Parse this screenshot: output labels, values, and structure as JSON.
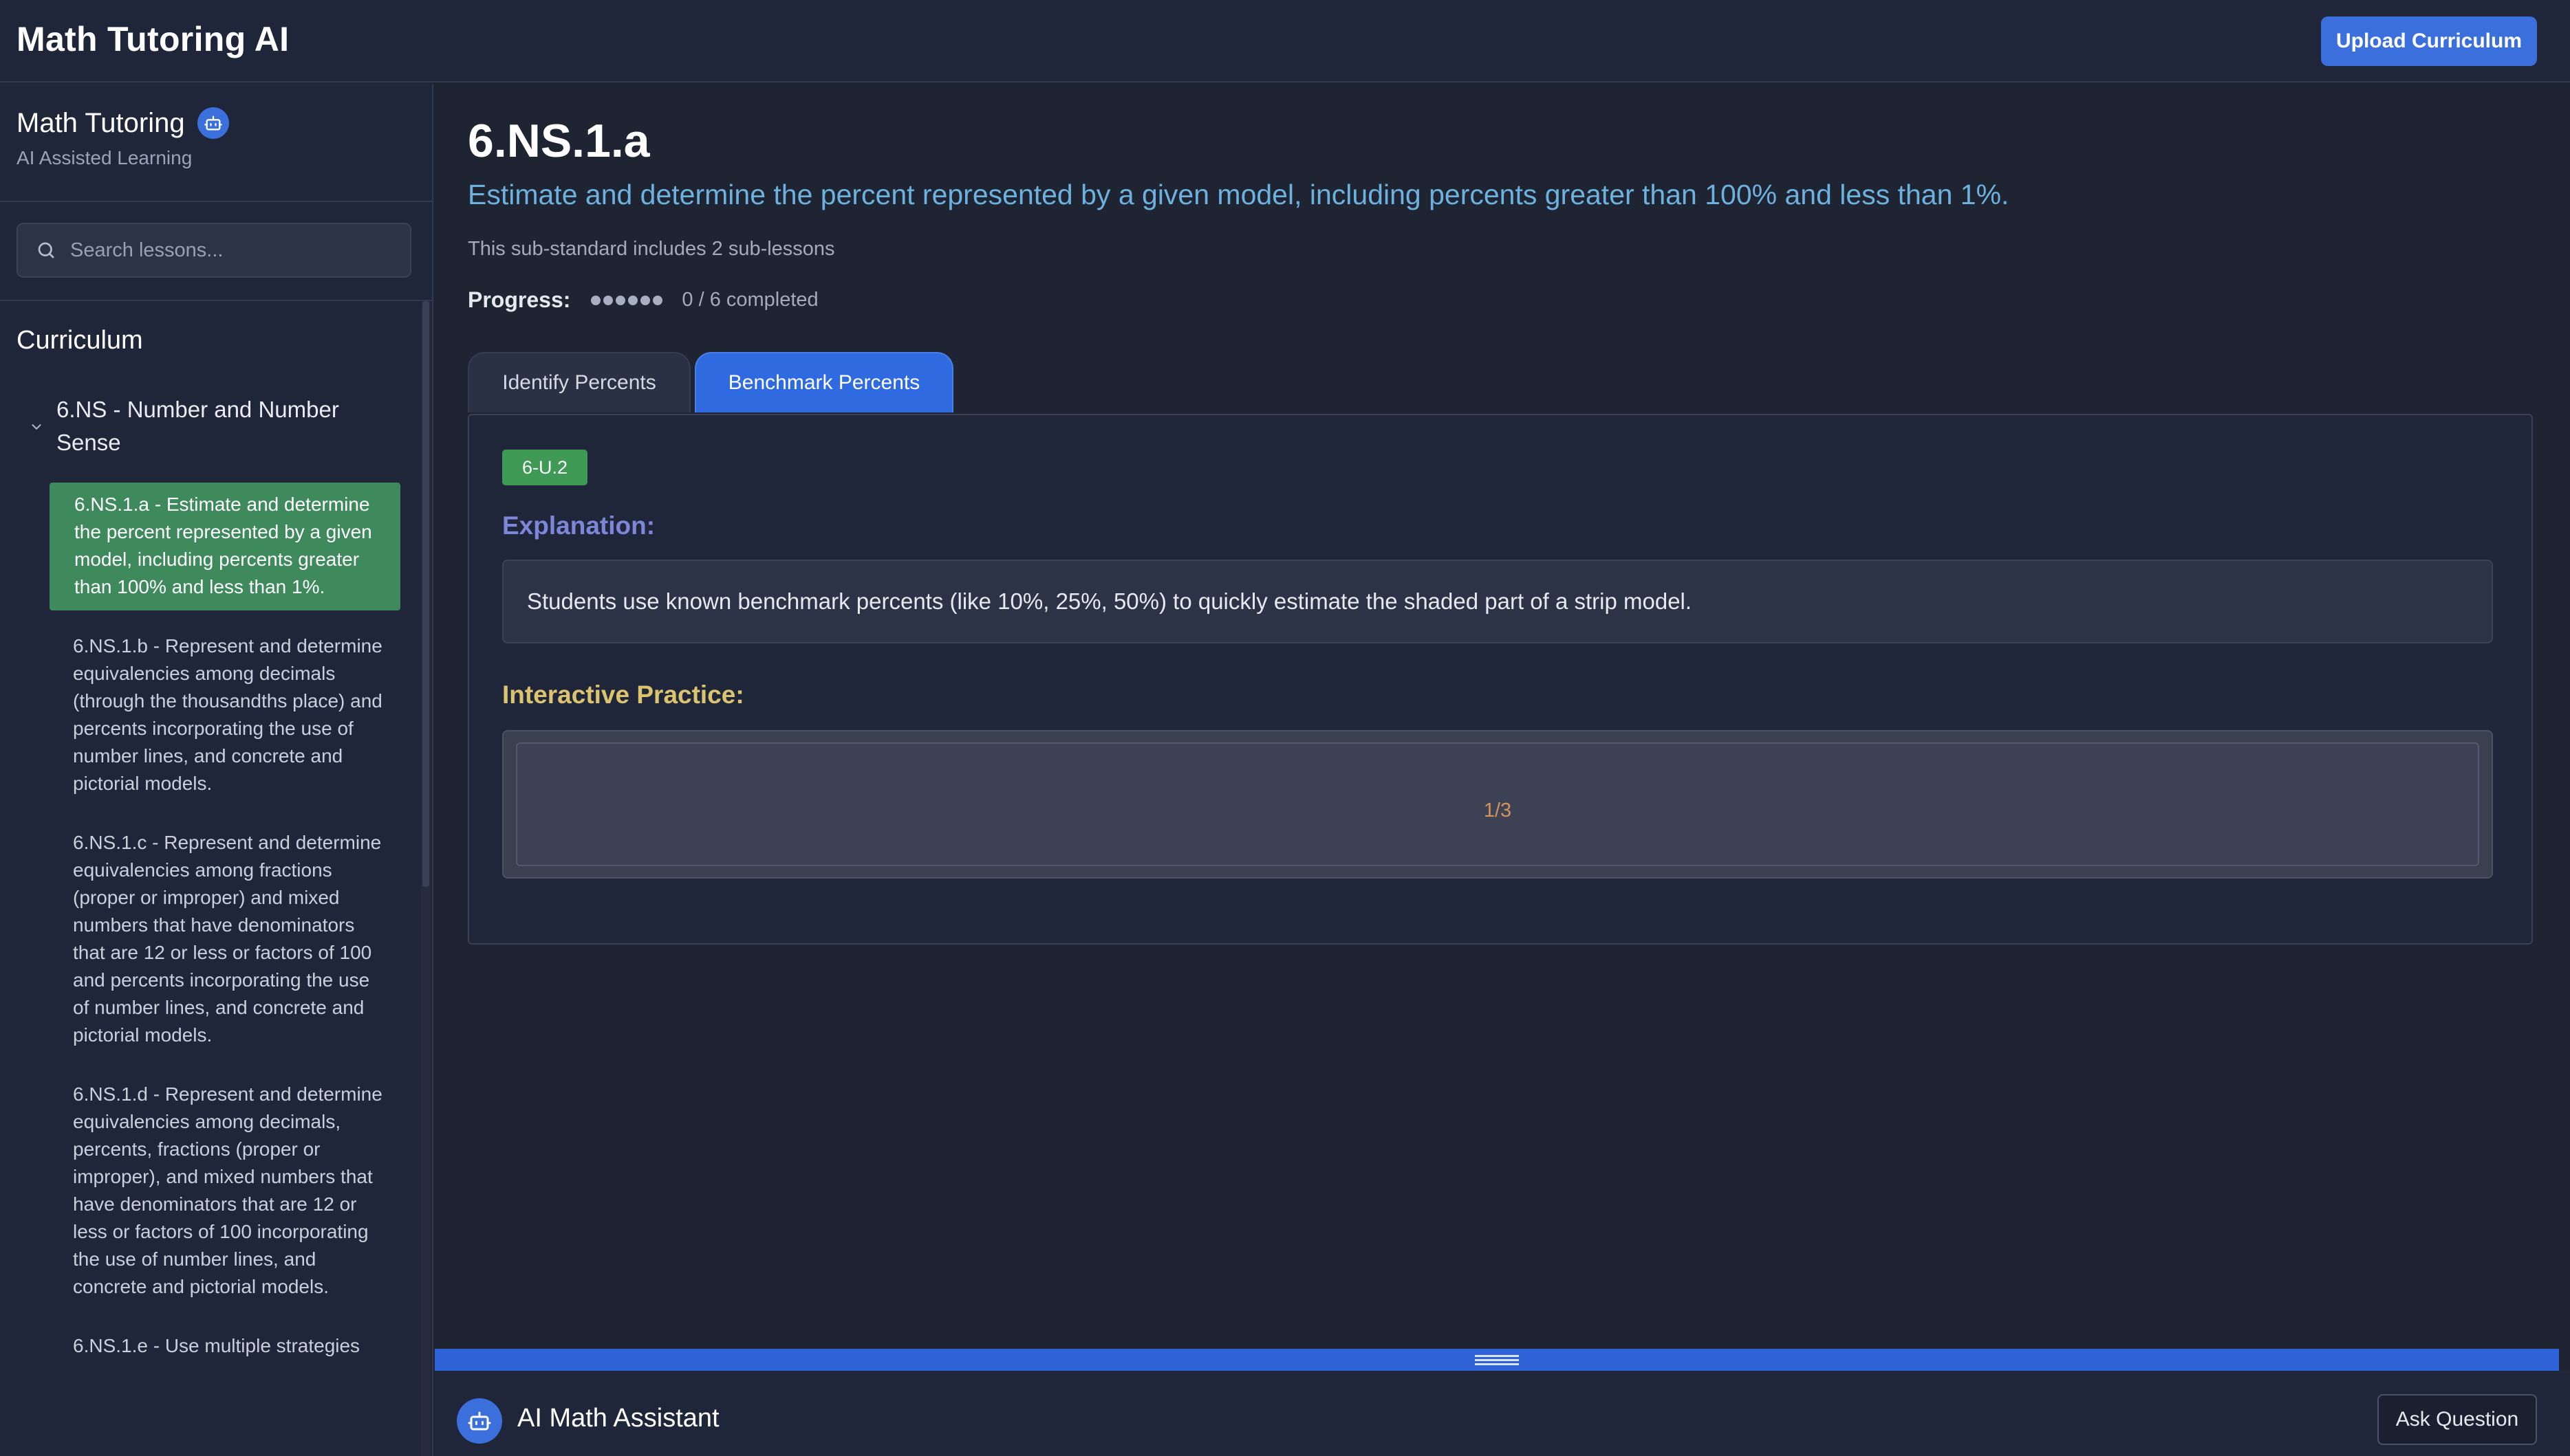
{
  "header": {
    "app_title": "Math Tutoring AI",
    "upload_label": "Upload Curriculum"
  },
  "sidebar": {
    "brand_title": "Math Tutoring",
    "brand_subtitle": "AI Assisted Learning",
    "search_placeholder": "Search lessons...",
    "curriculum_heading": "Curriculum",
    "group_label": "6.NS - Number and Number Sense",
    "lessons": [
      {
        "label": "6.NS.1.a - Estimate and determine the percent represented by a given model, including percents greater than 100% and less than 1%.",
        "active": true
      },
      {
        "label": "6.NS.1.b - Represent and determine equivalencies among decimals (through the thousandths place) and percents incorporating the use of number lines, and concrete and pictorial models.",
        "active": false
      },
      {
        "label": "6.NS.1.c - Represent and determine equivalencies among fractions (proper or improper) and mixed numbers that have denominators that are 12 or less or factors of 100 and percents incorporating the use of number lines, and concrete and pictorial models.",
        "active": false
      },
      {
        "label": "6.NS.1.d - Represent and determine equivalencies among decimals, percents, fractions (proper or improper), and mixed numbers that have denominators that are 12 or less or factors of 100 incorporating the use of number lines, and concrete and pictorial models.",
        "active": false
      },
      {
        "label": "6.NS.1.e - Use multiple strategies",
        "active": false
      }
    ]
  },
  "main": {
    "standard_code": "6.NS.1.a",
    "standard_description": "Estimate and determine the percent represented by a given model, including percents greater than 100% and less than 1%.",
    "sub_lesson_count_text": "This sub-standard includes 2 sub-lessons",
    "progress_label": "Progress:",
    "progress_completed": 0,
    "progress_total": 6,
    "progress_text": "0 / 6 completed",
    "tabs": [
      {
        "label": "Identify Percents",
        "active": false
      },
      {
        "label": "Benchmark Percents",
        "active": true
      }
    ],
    "lesson_code": "6-U.2",
    "explanation_heading": "Explanation:",
    "explanation_text": "Students use known benchmark percents (like 10%, 25%, 50%) to quickly estimate the shaded part of a strip model.",
    "practice_heading": "Interactive Practice:",
    "practice_counter": "1/3"
  },
  "assistant": {
    "title": "AI Math Assistant",
    "ask_label": "Ask Question"
  },
  "colors": {
    "background": "#1f2433",
    "accent_blue": "#3b6fdb",
    "active_lesson_green": "#3e8a5d",
    "badge_green": "#3e9a55",
    "description_blue": "#6db1de",
    "explanation_purple": "#7d86d8",
    "practice_gold": "#dcc36f",
    "counter_orange": "#d6925a"
  }
}
